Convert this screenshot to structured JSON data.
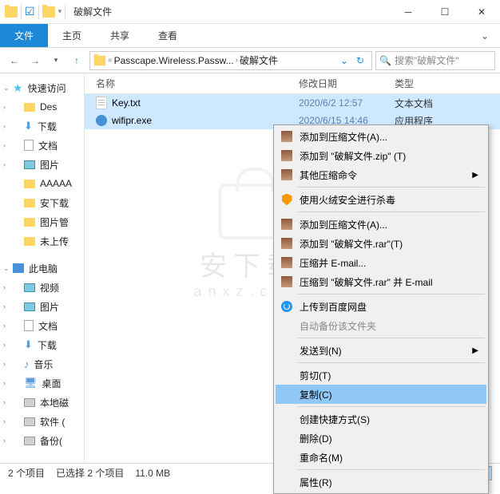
{
  "window": {
    "title": "破解文件"
  },
  "tabs": {
    "file": "文件",
    "home": "主页",
    "share": "共享",
    "view": "查看"
  },
  "breadcrumb": {
    "seg1": "Passcape.Wireless.Passw...",
    "seg2": "破解文件",
    "search_placeholder": "搜索\"破解文件\""
  },
  "columns": {
    "name": "名称",
    "date": "修改日期",
    "type": "类型"
  },
  "files": [
    {
      "name": "Key.txt",
      "date": "2020/6/2 12:57",
      "type": "文本文档"
    },
    {
      "name": "wifipr.exe",
      "date": "2020/6/15 14:46",
      "type": "应用程序"
    }
  ],
  "sidebar": {
    "quick": "快速访问",
    "items": [
      "Des",
      "下载",
      "文档",
      "图片",
      "AAAAA",
      "安下载",
      "图片管",
      "未上传"
    ],
    "thispc": "此电脑",
    "pc_items": [
      "视频",
      "图片",
      "文档",
      "下载",
      "音乐",
      "桌面",
      "本地磁",
      "软件 (",
      "备份("
    ]
  },
  "context": {
    "add_archive": "添加到压缩文件(A)...",
    "add_to_zip": "添加到 \"破解文件.zip\" (T)",
    "other_compress": "其他压缩命令",
    "huorong": "使用火绒安全进行杀毒",
    "add_archive2": "添加到压缩文件(A)...",
    "add_to_rar": "添加到 \"破解文件.rar\"(T)",
    "compress_email": "压缩并 E-mail...",
    "compress_rar_email": "压缩到 \"破解文件.rar\" 并 E-mail",
    "baidu": "上传到百度网盘",
    "auto_backup": "自动备份该文件夹",
    "send_to": "发送到(N)",
    "cut": "剪切(T)",
    "copy": "复制(C)",
    "shortcut": "创建快捷方式(S)",
    "delete": "删除(D)",
    "rename": "重命名(M)",
    "properties": "属性(R)"
  },
  "status": {
    "items": "2 个项目",
    "selected": "已选择 2 个项目",
    "size": "11.0 MB"
  },
  "watermark": {
    "top": "安下载",
    "bottom": "anxz.com"
  }
}
